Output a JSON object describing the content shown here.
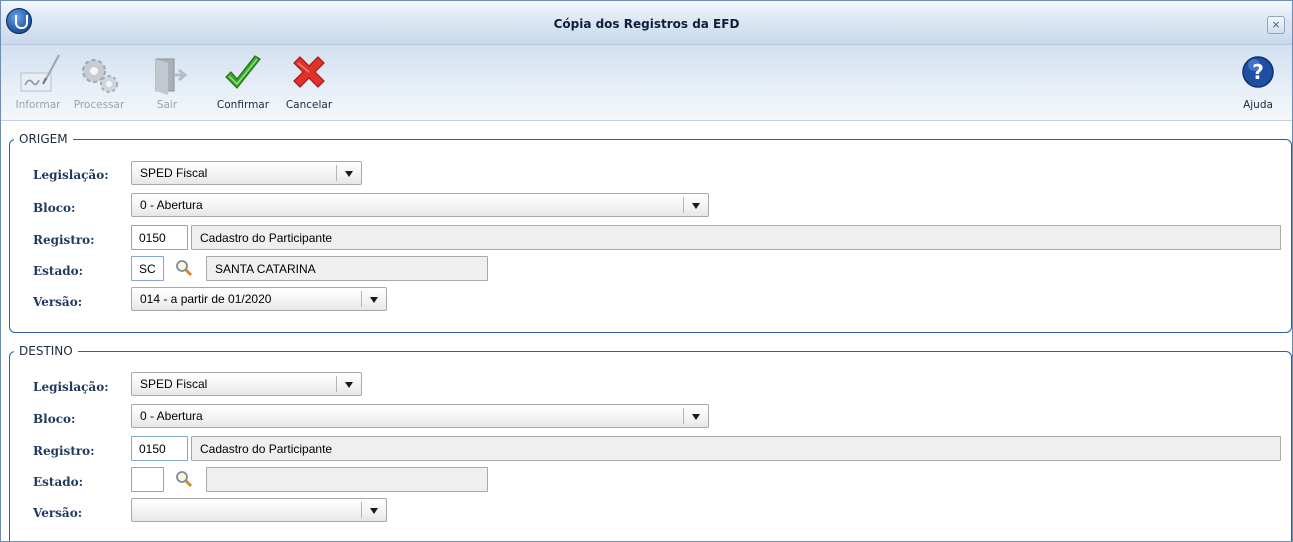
{
  "window": {
    "title": "Cópia dos Registros da EFD",
    "close_label": "×"
  },
  "toolbar": {
    "informar": "Informar",
    "processar": "Processar",
    "sair": "Sair",
    "confirmar": "Confirmar",
    "cancelar": "Cancelar",
    "ajuda": "Ajuda"
  },
  "labels": {
    "legislacao": "Legislação:",
    "bloco": "Bloco:",
    "registro": "Registro:",
    "estado": "Estado:",
    "versao": "Versão:"
  },
  "origem": {
    "legend": "ORIGEM",
    "legislacao": "SPED Fiscal",
    "bloco": "0 - Abertura",
    "registro_codigo": "0150",
    "registro_descricao": "Cadastro do Participante",
    "estado_sigla": "SC",
    "estado_nome": "SANTA CATARINA",
    "versao": "014 - a partir de 01/2020"
  },
  "destino": {
    "legend": "DESTINO",
    "legislacao": "SPED Fiscal",
    "bloco": "0 - Abertura",
    "registro_codigo": "0150",
    "registro_descricao": "Cadastro do Participante",
    "estado_sigla": "",
    "estado_nome": "",
    "versao": ""
  },
  "colors": {
    "accent": "#2d5fa0",
    "label": "#1f3a60",
    "confirm": "#3aa52a",
    "cancel": "#d9261c",
    "help": "#1f4fa3"
  }
}
